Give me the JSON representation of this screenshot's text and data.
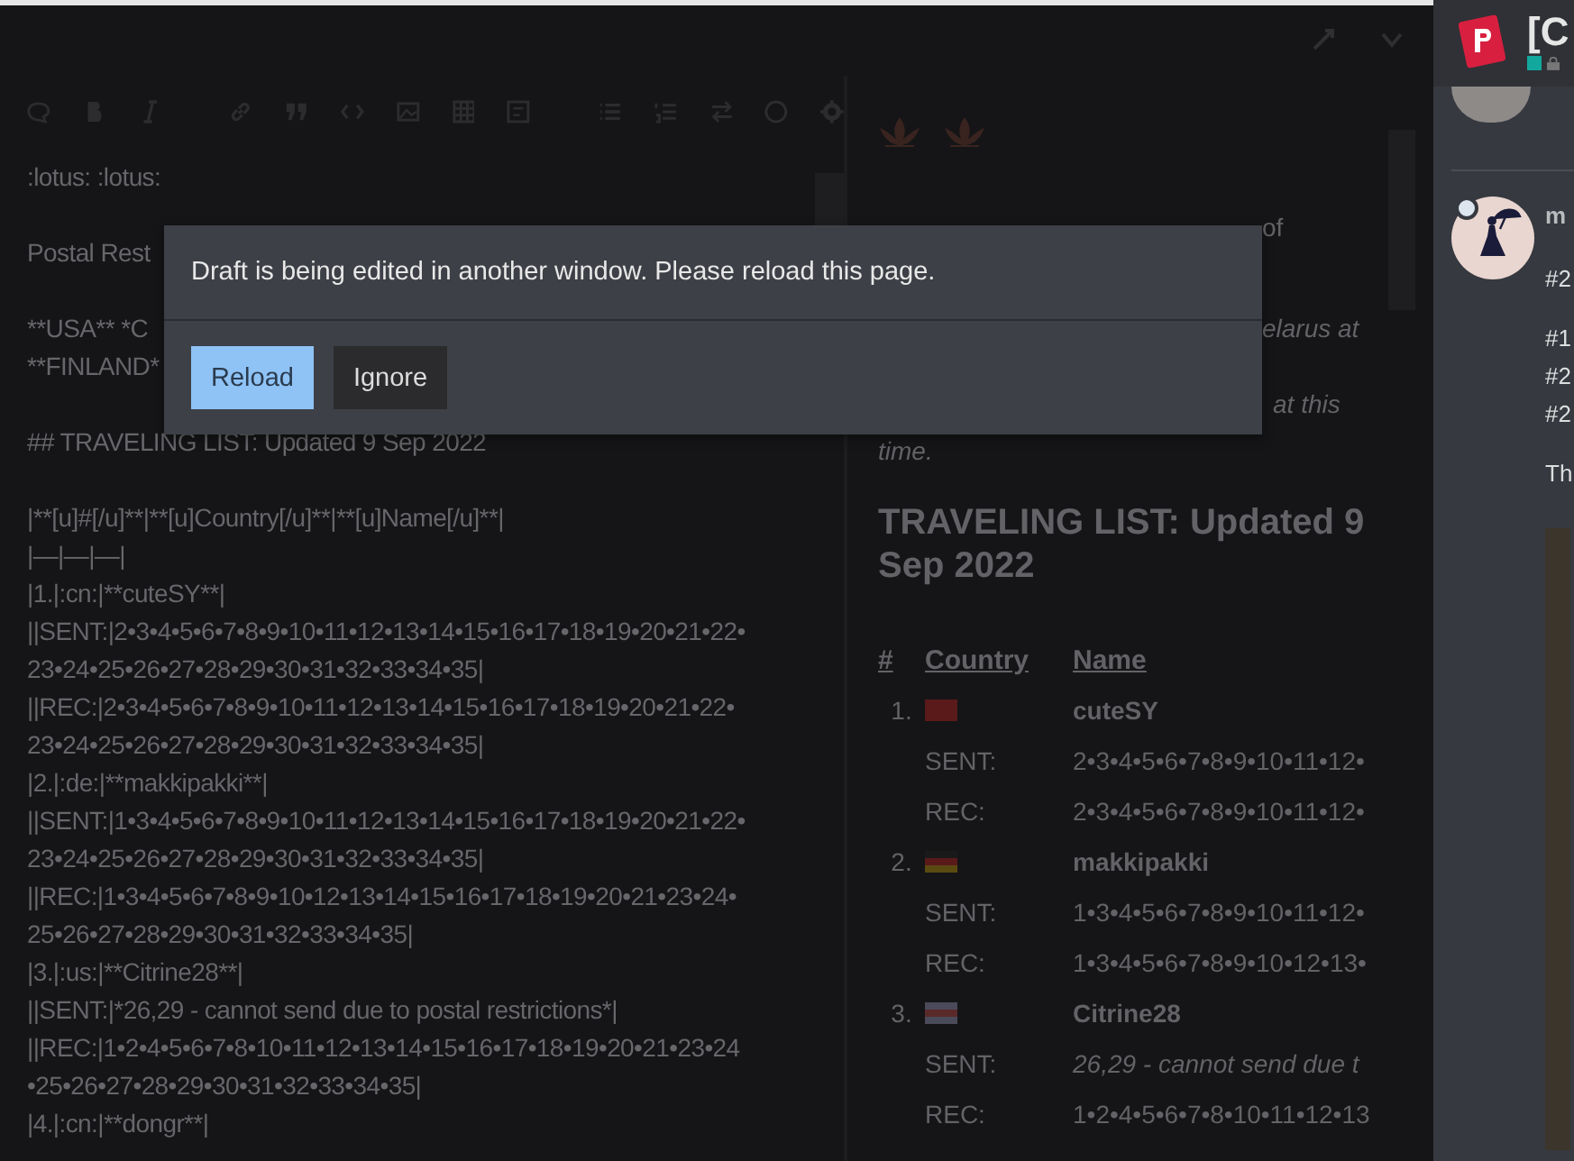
{
  "editor": {
    "paragraphs": [
      [
        ":lotus: :lotus:"
      ],
      [
        "Postal Rest"
      ],
      [
        "**USA** *C",
        "**FINLAND*"
      ],
      [
        "## TRAVELING LIST: Updated 9 Sep 2022"
      ],
      [
        "|**[u]#[/u]**|**[u]Country[/u]**|**[u]Name[/u]**|",
        "|—|—|—|",
        "|1.|:cn:|**cuteSY**|",
        "||SENT:|2•3•4•5•6•7•8•9•10•11•12•13•14•15•16•17•18•19•20•21•22•",
        "23•24•25•26•27•28•29•30•31•32•33•34•35|",
        "||REC:|2•3•4•5•6•7•8•9•10•11•12•13•14•15•16•17•18•19•20•21•22•",
        "23•24•25•26•27•28•29•30•31•32•33•34•35|",
        "|2.|:de:|**makkipakki**|",
        "||SENT:|1•3•4•5•6•7•8•9•10•11•12•13•14•15•16•17•18•19•20•21•22•",
        "23•24•25•26•27•28•29•30•31•32•33•34•35|",
        "||REC:|1•3•4•5•6•7•8•9•10•12•13•14•15•16•17•18•19•20•21•23•24•",
        "25•26•27•28•29•30•31•32•33•34•35|",
        "|3.|:us:|**Citrine28**|",
        "||SENT:|*26,29 - cannot send due to postal restrictions*|",
        "||REC:|1•2•4•5•6•7•8•10•11•12•13•14•15•16•17•18•19•20•21•23•24",
        "•25•26•27•28•29•30•31•32•33•34•35|",
        "|4.|:cn:|**dongr**|"
      ]
    ]
  },
  "preview": {
    "fragments": [
      {
        "text": "of",
        "italic": false
      },
      {
        "text": "elarus at",
        "italic": true
      },
      {
        "text": "at this",
        "italic": true
      },
      {
        "text": "time.",
        "italic": true
      }
    ],
    "title": "TRAVELING LIST: Updated 9 Sep 2022",
    "columns": [
      "#",
      "Country",
      "Name"
    ],
    "entries": [
      {
        "number": "1.",
        "kind": "cn",
        "name": "cuteSY",
        "rows": [
          {
            "label": "SENT:",
            "value": "2•3•4•5•6•7•8•9•10•11•12•",
            "italic": false
          },
          {
            "label": "REC:",
            "value": "2•3•4•5•6•7•8•9•10•11•12•",
            "italic": false
          }
        ]
      },
      {
        "number": "2.",
        "kind": "de",
        "name": "makkipakki",
        "rows": [
          {
            "label": "SENT:",
            "value": "1•3•4•5•6•7•8•9•10•11•12•",
            "italic": false
          },
          {
            "label": "REC:",
            "value": "1•3•4•5•6•7•8•9•10•12•13•",
            "italic": false
          }
        ]
      },
      {
        "number": "3.",
        "kind": "us",
        "name": "Citrine28",
        "rows": [
          {
            "label": "SENT:",
            "value": "26,29 - cannot send due t",
            "italic": true
          },
          {
            "label": "REC:",
            "value": "1•2•4•5•6•7•8•10•11•12•13",
            "italic": false
          }
        ]
      }
    ]
  },
  "dialog": {
    "message": "Draft is being edited in another window. Please reload this page.",
    "buttons": [
      {
        "label": "Reload",
        "kind": "primary"
      },
      {
        "label": "Ignore",
        "kind": "secondary"
      }
    ]
  },
  "sidebar": {
    "title": "[C",
    "post": {
      "username": "m",
      "paragraphs": [
        [
          "#2"
        ],
        [
          "#1",
          "#2",
          "#2"
        ],
        [
          "Th"
        ]
      ]
    }
  }
}
